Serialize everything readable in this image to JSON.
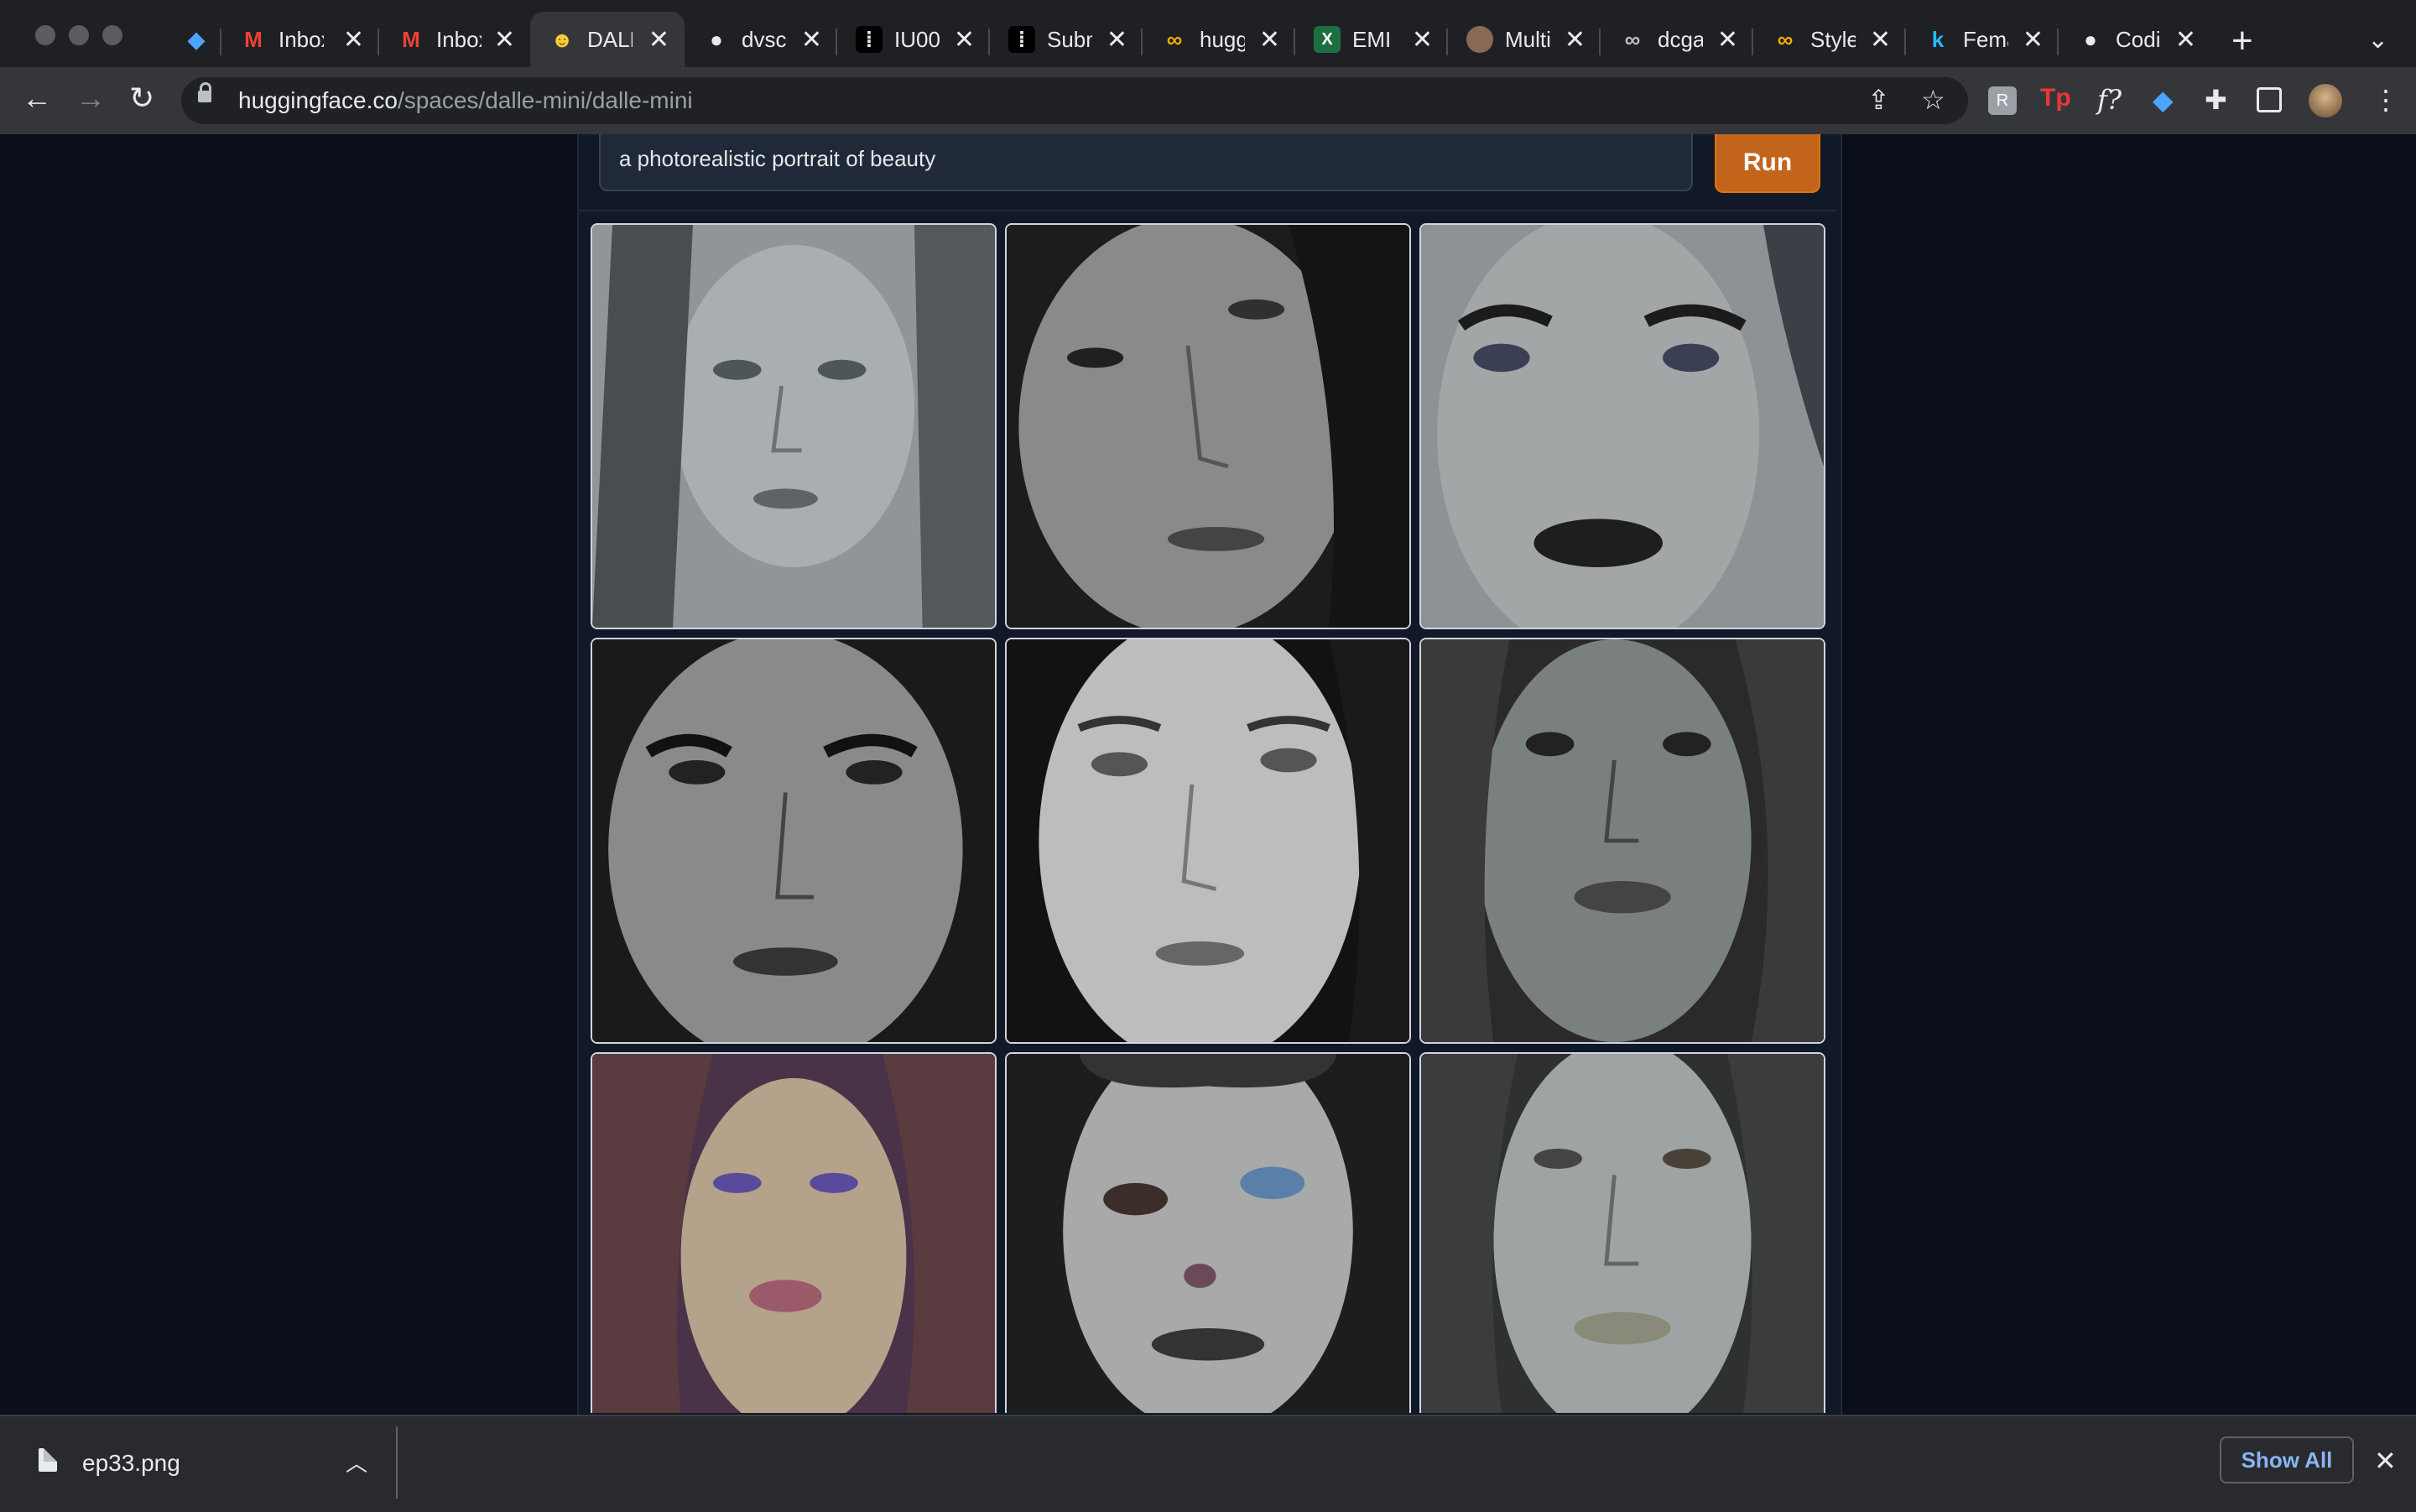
{
  "browser": {
    "tabs": [
      {
        "label": "",
        "icon": "diamond-icon",
        "active": false
      },
      {
        "label": "Inbox",
        "icon": "gmail-icon",
        "active": false
      },
      {
        "label": "Inbox",
        "icon": "gmail-icon",
        "active": false
      },
      {
        "label": "DALL",
        "icon": "hugging-face-icon",
        "active": true
      },
      {
        "label": "dvsc",
        "icon": "github-icon",
        "active": false
      },
      {
        "label": "IU00",
        "icon": "app-icon",
        "active": false
      },
      {
        "label": "Subm",
        "icon": "app-icon",
        "active": false
      },
      {
        "label": "hugg",
        "icon": "colab-icon",
        "active": false
      },
      {
        "label": "EMI I",
        "icon": "excel-icon",
        "active": false
      },
      {
        "label": "Multi",
        "icon": "image-icon",
        "active": false
      },
      {
        "label": "dcga",
        "icon": "colab-icon",
        "active": false
      },
      {
        "label": "Style",
        "icon": "colab-icon",
        "active": false
      },
      {
        "label": "Fema",
        "icon": "kaggle-icon",
        "active": false
      },
      {
        "label": "Codi",
        "icon": "github-icon",
        "active": false
      }
    ],
    "url_domain": "huggingface.co",
    "url_path": "/spaces/dalle-mini/dalle-mini"
  },
  "app": {
    "prompt_value": "a photorealistic portrait  of beauty",
    "run_label": "Run",
    "accent_color": "#c2641c",
    "gallery_count": 9
  },
  "downloads": {
    "file_name": "ep33.png",
    "show_all_label": "Show All"
  }
}
